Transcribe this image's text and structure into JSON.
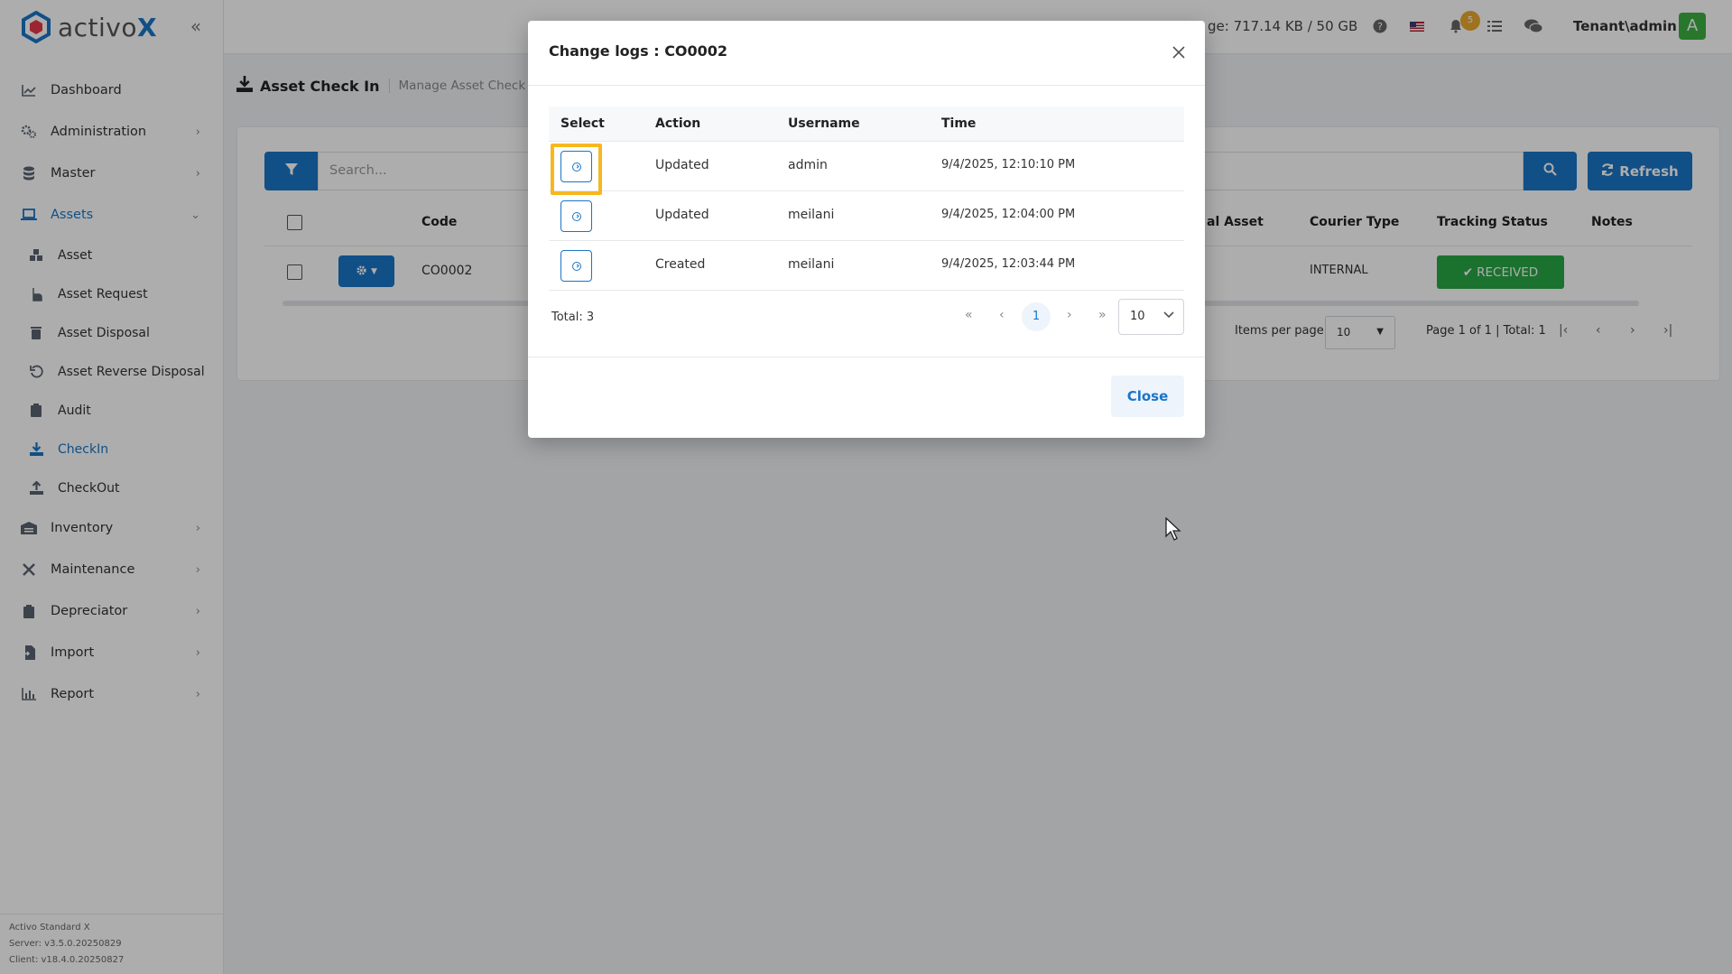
{
  "app": {
    "logo_text": "activo",
    "logo_x": "X",
    "storage_text": "ge: 717.14 KB / 50 GB",
    "notification_count": "5",
    "user_name": "Tenant\\admin",
    "avatar_letter": "A"
  },
  "sidebar": {
    "items": [
      {
        "label": "Dashboard",
        "icon": "chart-line-icon"
      },
      {
        "label": "Administration",
        "icon": "gears-icon"
      },
      {
        "label": "Master",
        "icon": "database-icon"
      },
      {
        "label": "Assets",
        "icon": "laptop-icon"
      },
      {
        "label": "Inventory",
        "icon": "warehouse-icon"
      },
      {
        "label": "Maintenance",
        "icon": "tools-icon"
      },
      {
        "label": "Depreciator",
        "icon": "clipboard-icon"
      },
      {
        "label": "Import",
        "icon": "file-import-icon"
      },
      {
        "label": "Report",
        "icon": "chart-bar-icon"
      }
    ],
    "asset_sub": [
      {
        "label": "Asset",
        "icon": "cubes-icon"
      },
      {
        "label": "Asset Request",
        "icon": "hand-icon"
      },
      {
        "label": "Asset Disposal",
        "icon": "trash-icon"
      },
      {
        "label": "Asset Reverse Disposal",
        "icon": "undo-icon"
      },
      {
        "label": "Audit",
        "icon": "clipboard-check-icon"
      },
      {
        "label": "CheckIn",
        "icon": "download-icon"
      },
      {
        "label": "CheckOut",
        "icon": "upload-icon"
      }
    ],
    "version": {
      "line1": "Activo Standard X",
      "line2": "Server: v3.5.0.20250829",
      "line3": "Client: v18.4.0.20250827"
    }
  },
  "page": {
    "title": "Asset Check In",
    "subtitle": "Manage Asset Check In",
    "search_placeholder": "Search...",
    "refresh_label": "Refresh",
    "columns": {
      "code": "Code",
      "original_asset": "al Asset",
      "courier_type": "Courier Type",
      "tracking_status": "Tracking Status",
      "notes": "Notes"
    },
    "row": {
      "code": "CO0002",
      "courier_type": "INTERNAL",
      "tracking_status": "RECEIVED"
    },
    "pager": {
      "items_per_page_label": "Items per page",
      "items_per_page": "10",
      "summary": "Page 1 of 1 | Total: 1"
    }
  },
  "modal": {
    "title": "Change logs : CO0002",
    "headers": {
      "select": "Select",
      "action": "Action",
      "username": "Username",
      "time": "Time"
    },
    "rows": [
      {
        "action": "Updated",
        "username": "admin",
        "time": "9/4/2025, 12:10:10 PM"
      },
      {
        "action": "Updated",
        "username": "meilani",
        "time": "9/4/2025, 12:04:00 PM"
      },
      {
        "action": "Created",
        "username": "meilani",
        "time": "9/4/2025, 12:03:44 PM"
      }
    ],
    "total": "Total: 3",
    "current_page": "1",
    "page_size": "10",
    "close_label": "Close"
  },
  "colors": {
    "primary": "#1a75c7",
    "success": "#28a745",
    "highlight": "#f6b81f",
    "badge": "#e9a92f"
  }
}
